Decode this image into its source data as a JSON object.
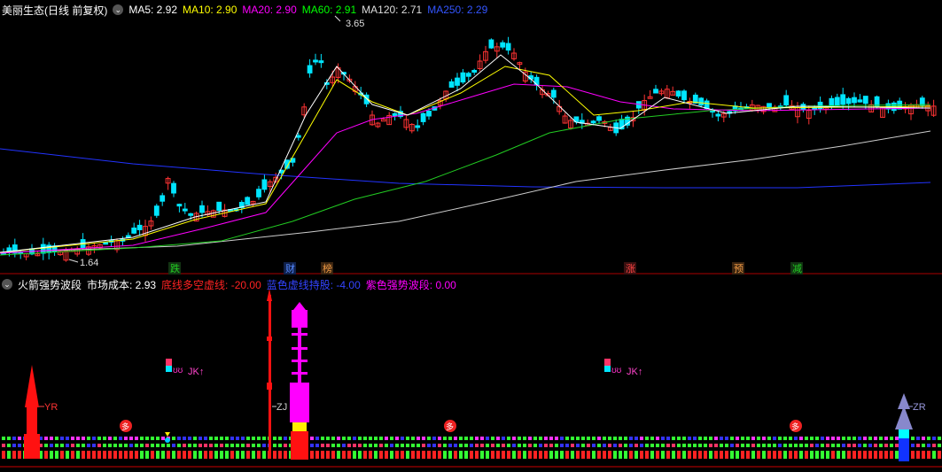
{
  "main_header": {
    "title": "美丽生态(日线 前复权)",
    "ma": [
      {
        "label": "MA5: 2.92",
        "color": "#ffffff"
      },
      {
        "label": "MA10: 2.90",
        "color": "#ffff00"
      },
      {
        "label": "MA20: 2.90",
        "color": "#ff00ff"
      },
      {
        "label": "MA60: 2.91",
        "color": "#00ff00"
      },
      {
        "label": "MA120: 2.71",
        "color": "#dddddd"
      },
      {
        "label": "MA250: 2.29",
        "color": "#0000ff"
      }
    ]
  },
  "price_labels": {
    "high": "3.65",
    "low": "1.64"
  },
  "event_tags": [
    {
      "text": "跌",
      "color": "#22aa22"
    },
    {
      "text": "财",
      "color": "#2255ee"
    },
    {
      "text": "榜",
      "color": "#cc7722"
    },
    {
      "text": "涨",
      "color": "#ee2222"
    },
    {
      "text": "预",
      "color": "#cc7722"
    },
    {
      "text": "减",
      "color": "#22aa22"
    }
  ],
  "indicator_header": {
    "name": "火箭强势波段",
    "cost_label": "市场成本: 2.93",
    "items": [
      {
        "label": "底线多空虚线: -20.00",
        "color": "#ff2222"
      },
      {
        "label": "蓝色虚线持股: -4.00",
        "color": "#3333ff"
      },
      {
        "label": "紫色强势波段: 0.00",
        "color": "#ff00ff"
      }
    ]
  },
  "signal_labels": {
    "yr": "YR",
    "zj": "ZJ",
    "zr": "ZR",
    "jk1": "JK↑",
    "jk2": "JK↑",
    "duo": "多"
  },
  "colors": {
    "up": "#ff3333",
    "down": "#00e5ff",
    "bg": "#000000",
    "divider": "#ff2222"
  }
}
